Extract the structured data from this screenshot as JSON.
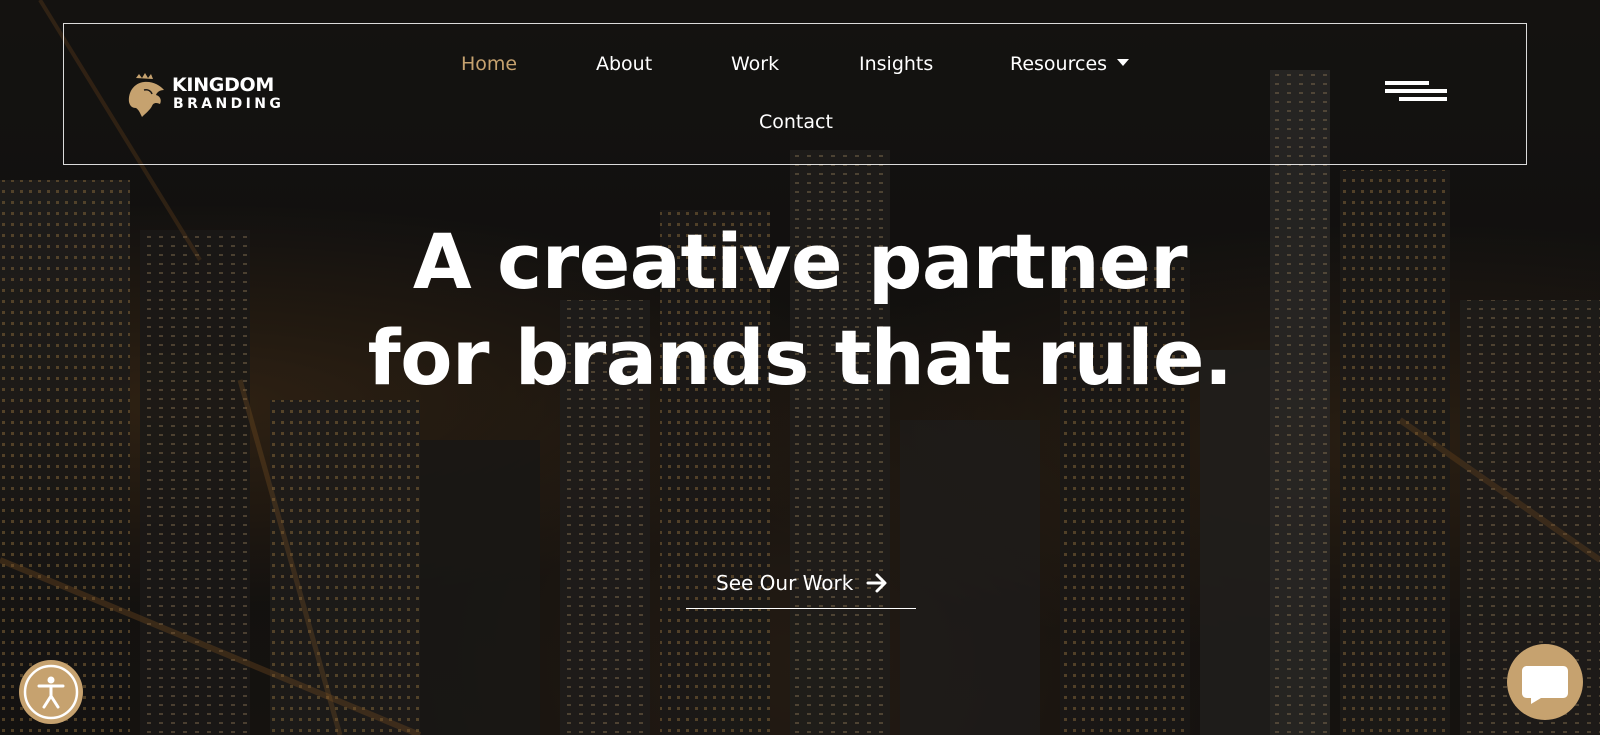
{
  "brand": {
    "name_line1": "KINGDOM",
    "name_line2": "BRANDING",
    "accent_color": "#c6a26f"
  },
  "nav": {
    "items": [
      {
        "label": "Home",
        "active": true
      },
      {
        "label": "About",
        "active": false
      },
      {
        "label": "Work",
        "active": false
      },
      {
        "label": "Insights",
        "active": false
      },
      {
        "label": "Resources",
        "active": false,
        "has_dropdown": true
      },
      {
        "label": "Contact",
        "active": false
      }
    ],
    "menu_icon": "hamburger-icon"
  },
  "hero": {
    "headline_line1": "A creative partner",
    "headline_line2": "for brands that rule.",
    "cta_label": "See Our Work",
    "cta_icon": "arrow-right-icon",
    "background": "aerial night city skyline"
  },
  "widgets": {
    "accessibility_icon": "accessibility-icon",
    "chat_icon": "chat-bubble-icon"
  }
}
